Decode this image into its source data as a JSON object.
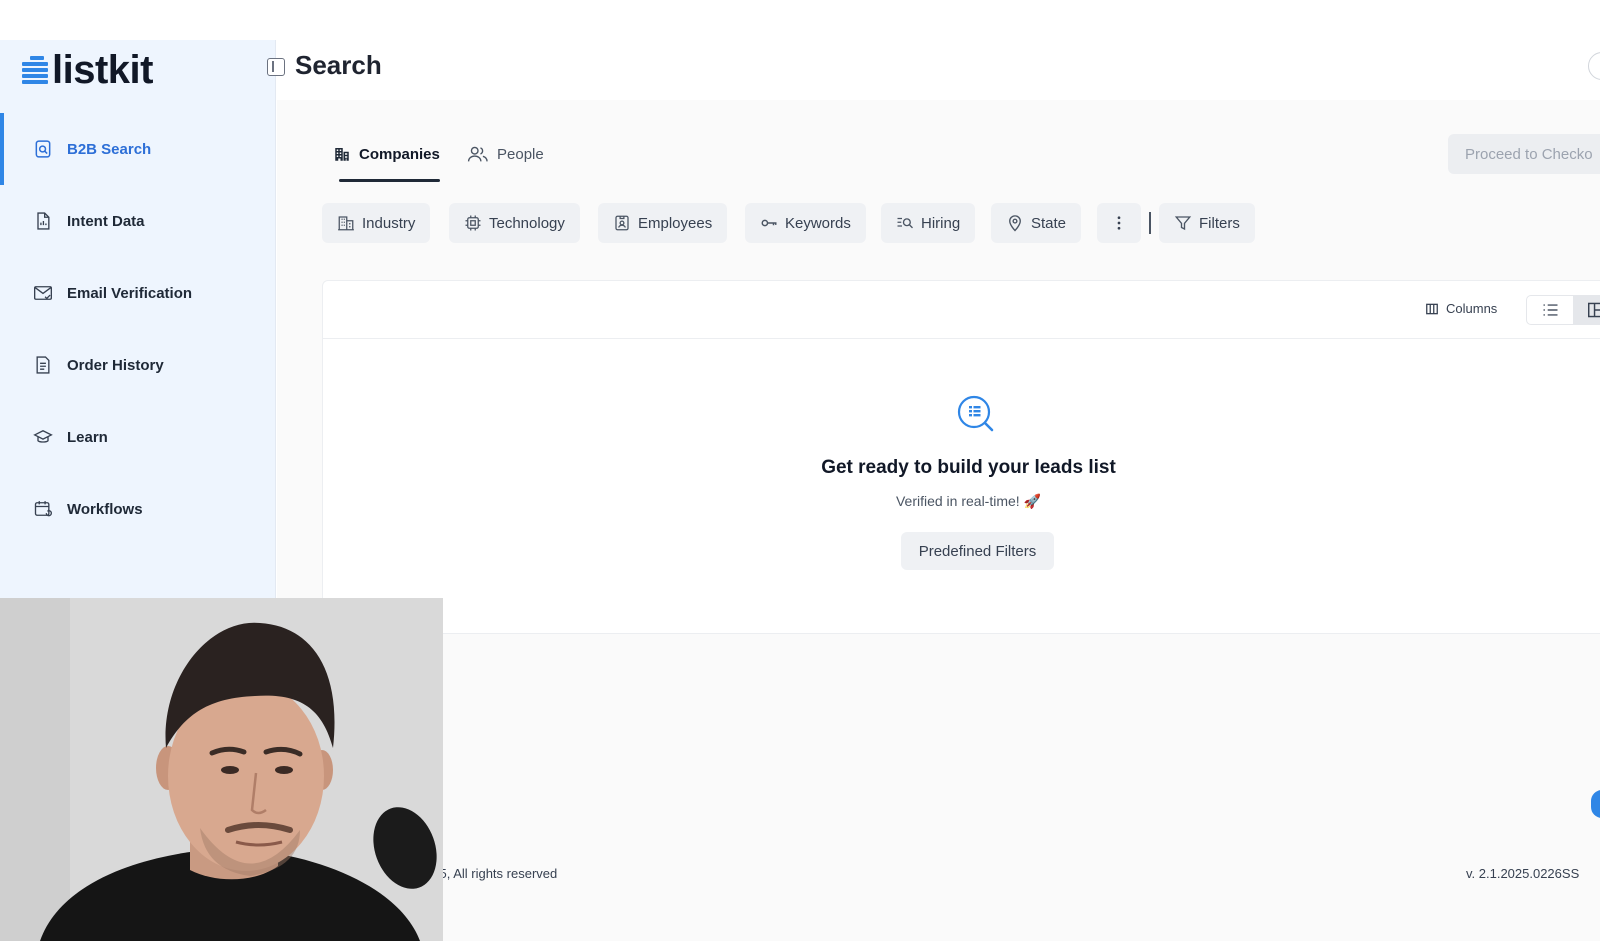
{
  "app": {
    "logo_text": "listkit"
  },
  "header": {
    "title": "Search"
  },
  "sidebar": {
    "items": [
      {
        "label": "B2B Search",
        "icon": "search-document-icon",
        "active": true
      },
      {
        "label": "Intent Data",
        "icon": "document-chart-icon",
        "active": false
      },
      {
        "label": "Email Verification",
        "icon": "mail-check-icon",
        "active": false
      },
      {
        "label": "Order History",
        "icon": "receipt-icon",
        "active": false
      },
      {
        "label": "Learn",
        "icon": "graduation-cap-icon",
        "active": false
      },
      {
        "label": "Workflows",
        "icon": "calendar-cycle-icon",
        "active": false
      }
    ]
  },
  "tabs": [
    {
      "label": "Companies",
      "icon": "building-icon",
      "active": true
    },
    {
      "label": "People",
      "icon": "users-icon",
      "active": false
    }
  ],
  "checkout_button": {
    "label": "Proceed to Checko"
  },
  "filters": [
    {
      "label": "Industry",
      "icon": "building-outline-icon"
    },
    {
      "label": "Technology",
      "icon": "chip-icon"
    },
    {
      "label": "Employees",
      "icon": "badge-icon"
    },
    {
      "label": "Keywords",
      "icon": "key-icon"
    },
    {
      "label": "Hiring",
      "icon": "list-search-icon"
    },
    {
      "label": "State",
      "icon": "map-pin-icon"
    },
    {
      "label": "",
      "icon": "more-vertical-icon"
    },
    {
      "label": "Filters",
      "icon": "funnel-icon"
    }
  ],
  "results": {
    "columns_label": "Columns",
    "empty_title": "Get ready to build your leads list",
    "empty_subtitle": "Verified in real-time! 🚀",
    "predefined_button": "Predefined Filters"
  },
  "footer": {
    "copyright": "025, All rights reserved",
    "version": "v. 2.1.2025.0226SS"
  },
  "colors": {
    "accent": "#2f86e6",
    "sidebar_bg": "#eef5fe",
    "active_text": "#2d6fd7"
  }
}
